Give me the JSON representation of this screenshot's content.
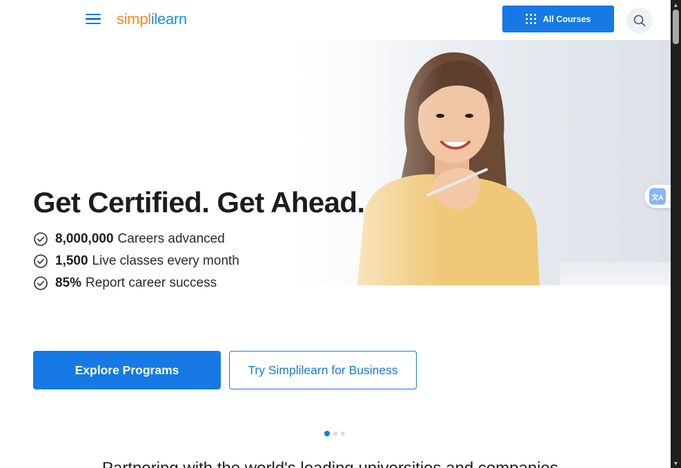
{
  "header": {
    "logo_part1": "simpl",
    "logo_part2": "ilearn",
    "all_courses_label": "All Courses",
    "menu_icon": "hamburger-menu-icon",
    "search_icon": "search-icon"
  },
  "hero": {
    "headline": "Get Certified. Get Ahead.",
    "stats": [
      {
        "value": "8,000,000",
        "label": "Careers advanced"
      },
      {
        "value": "1,500",
        "label": "Live classes every month"
      },
      {
        "value": "85%",
        "label": "Report career success"
      }
    ],
    "primary_button": "Explore Programs",
    "secondary_button": "Try Simplilearn for Business",
    "carousel": {
      "count": 3,
      "active": 1
    }
  },
  "partner_heading": "Partnering with the world's leading universities and companies",
  "colors": {
    "accent": "#1679e4",
    "logo_orange": "#f28c1d",
    "logo_blue": "#1a8ee6"
  }
}
